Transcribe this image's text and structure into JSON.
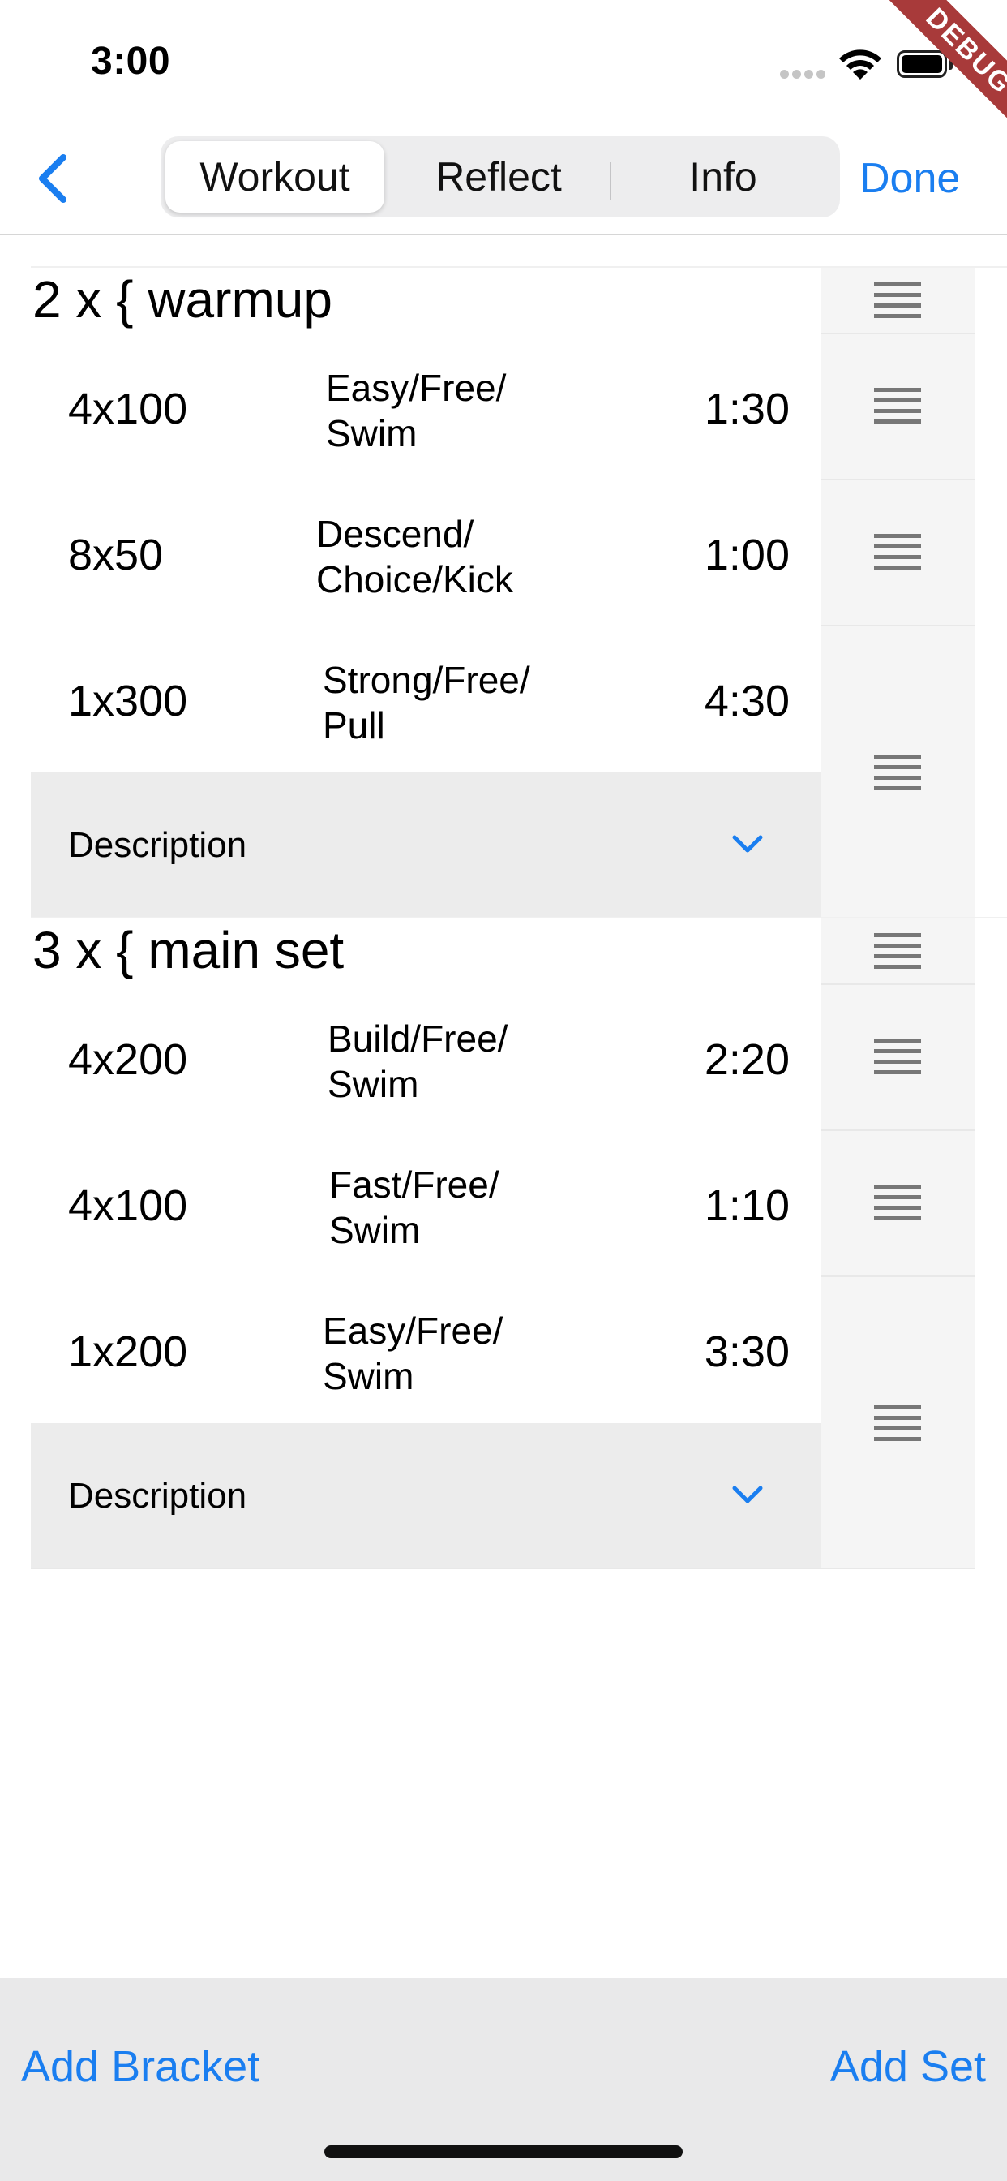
{
  "status_bar": {
    "time": "3:00",
    "debug_label": "DEBUG"
  },
  "nav": {
    "back_icon": "chevron-left-icon",
    "tabs": [
      {
        "label": "Workout",
        "selected": true
      },
      {
        "label": "Reflect",
        "selected": false
      },
      {
        "label": "Info",
        "selected": false
      }
    ],
    "done_label": "Done"
  },
  "brackets": [
    {
      "title": "2 x { warmup",
      "sets": [
        {
          "reps": "4x100",
          "description": "Easy/Free/\nSwim",
          "interval": "1:30"
        },
        {
          "reps": "8x50",
          "description": "Descend/\nChoice/Kick",
          "interval": "1:00"
        },
        {
          "reps": "1x300",
          "description": "Strong/Free/\nPull",
          "interval": "4:30"
        }
      ],
      "description_label": "Description"
    },
    {
      "title": "3 x { main set",
      "sets": [
        {
          "reps": "4x200",
          "description": "Build/Free/\nSwim",
          "interval": "2:20"
        },
        {
          "reps": "4x100",
          "description": "Fast/Free/\nSwim",
          "interval": "1:10"
        },
        {
          "reps": "1x200",
          "description": "Easy/Free/\nSwim",
          "interval": "3:30"
        }
      ],
      "description_label": "Description"
    }
  ],
  "toolbar": {
    "add_bracket_label": "Add Bracket",
    "add_set_label": "Add Set"
  },
  "colors": {
    "accent": "#1a7ef0",
    "debug_ribbon": "#a83a3a",
    "toolbar_bg": "#e9e9ea"
  }
}
